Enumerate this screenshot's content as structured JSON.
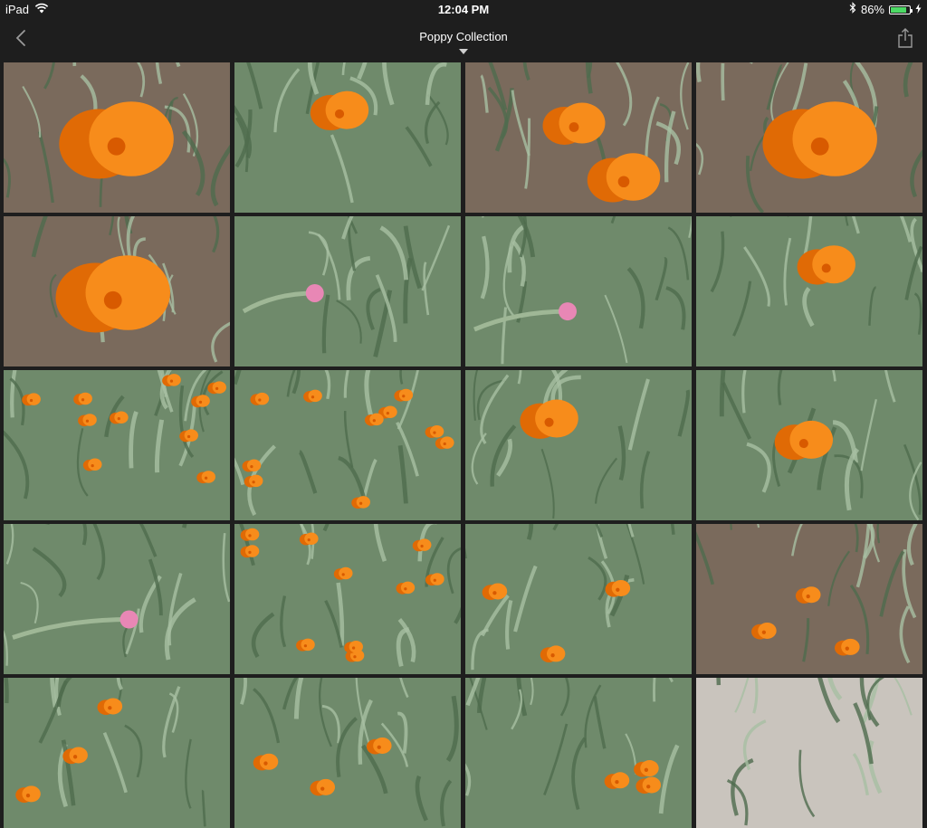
{
  "status_bar": {
    "device": "iPad",
    "time": "12:04 PM",
    "battery": "86%",
    "battery_level": 0.86,
    "icons": [
      "wifi-icon",
      "bluetooth-icon",
      "battery-icon",
      "charging-icon"
    ]
  },
  "nav": {
    "title": "Poppy Collection",
    "icons": [
      "chevron-left-icon",
      "caret-down-icon",
      "share-icon"
    ]
  },
  "colors": {
    "background": "#1e1e1e",
    "poppy_orange": "#f78c1b",
    "poppy_dark": "#e06a05",
    "foliage": "#6f8a6b",
    "foliage_light": "#a8bfa3",
    "soil": "#7a6a5c",
    "pink_bud": "#e887b5",
    "battery_green": "#4cd964"
  },
  "photos": [
    {
      "ground": "soil",
      "poppy": "big"
    },
    {
      "ground": "grass",
      "poppy": "one"
    },
    {
      "ground": "soil",
      "poppy": "pair"
    },
    {
      "ground": "soil",
      "poppy": "big"
    },
    {
      "ground": "soil",
      "poppy": "big"
    },
    {
      "ground": "grass",
      "poppy": "bud"
    },
    {
      "ground": "grass",
      "poppy": "bud"
    },
    {
      "ground": "grass",
      "poppy": "one"
    },
    {
      "ground": "grass",
      "poppy": "many"
    },
    {
      "ground": "grass",
      "poppy": "many"
    },
    {
      "ground": "grass",
      "poppy": "one"
    },
    {
      "ground": "grass",
      "poppy": "one"
    },
    {
      "ground": "grass",
      "poppy": "bud"
    },
    {
      "ground": "grass",
      "poppy": "many"
    },
    {
      "ground": "grass",
      "poppy": "few"
    },
    {
      "ground": "soil",
      "poppy": "few"
    },
    {
      "ground": "grass",
      "poppy": "few"
    },
    {
      "ground": "grass",
      "poppy": "few"
    },
    {
      "ground": "grass",
      "poppy": "few"
    },
    {
      "ground": "light",
      "poppy": "none"
    }
  ]
}
